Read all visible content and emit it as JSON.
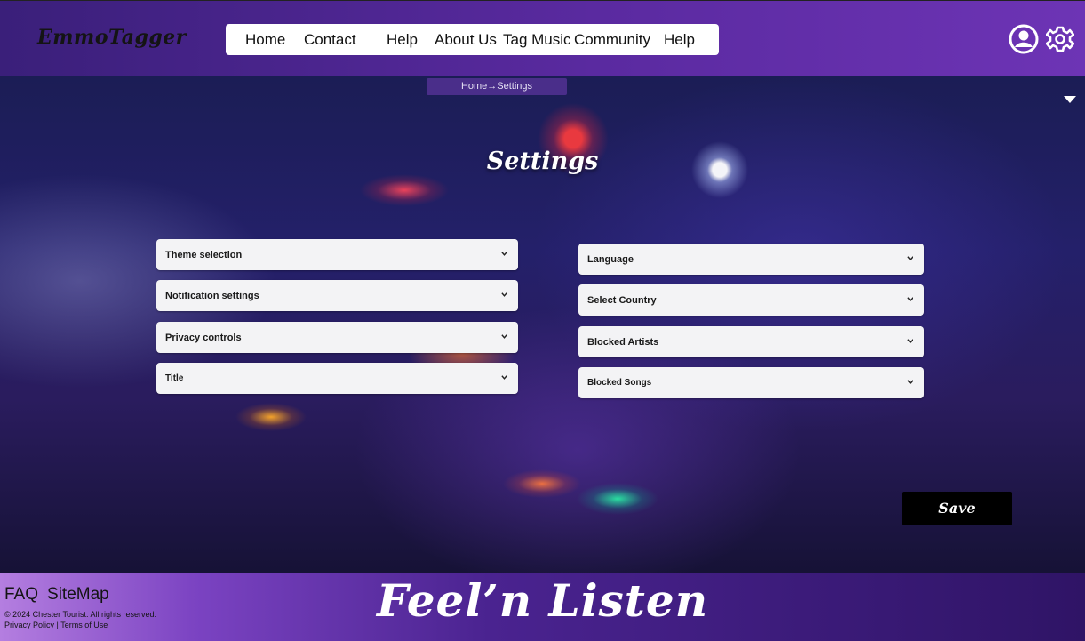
{
  "app": {
    "logo": "EmmoTagger"
  },
  "nav": {
    "items": [
      "Home",
      "Contact",
      "Help",
      "About Us",
      "Tag Music",
      "Community",
      "Help"
    ]
  },
  "header_icons": {
    "profile": "user-circle-icon",
    "settings": "gear-icon"
  },
  "breadcrumb": "Home→Settings",
  "page_title": "Settings",
  "settings_left": [
    "Theme selection",
    "Notification settings",
    "Privacy controls",
    "Title"
  ],
  "settings_right": [
    "Language",
    "Select Country",
    "Blocked Artists",
    "Blocked Songs"
  ],
  "save_label": "Save",
  "footer": {
    "links": [
      "FAQ",
      "SiteMap"
    ],
    "copyright": "© 2024 Chester Tourist. All rights reserved.",
    "privacy": "Privacy Policy",
    "separator": "|",
    "terms": "Terms of Use",
    "tagline": "Feel’n Listen"
  },
  "colors": {
    "header": "#5a2aa0",
    "breadcrumb_bg": "#4a2e8a",
    "save_bg": "#000000",
    "dropdown_bg": "#f3f3f5"
  }
}
